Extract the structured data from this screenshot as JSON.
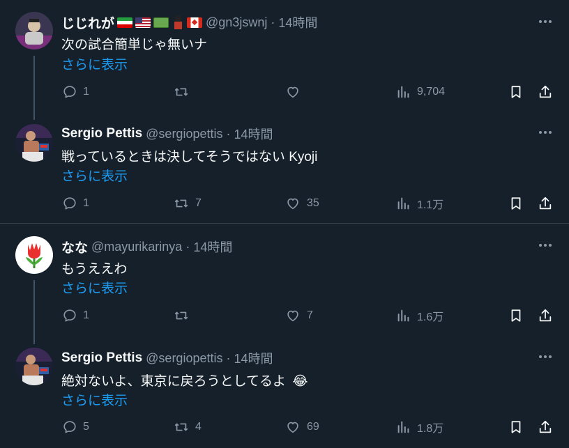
{
  "tweets": [
    {
      "name": "じじれが",
      "handle": "@gn3jswnj",
      "time": "14時間",
      "text": "次の試合簡単じゃ無いナ",
      "show_more": "さらに表示",
      "replies": "1",
      "retweets": "",
      "likes": "",
      "views": "9,704",
      "flags": [
        "iran-flag",
        "us-flag",
        "money-icon",
        "guard-icon",
        "canada-flag"
      ]
    },
    {
      "name": "Sergio Pettis",
      "handle": "@sergiopettis",
      "time": "14時間",
      "text": "戦っているときは決してそうではない Kyoji",
      "show_more": "さらに表示",
      "replies": "1",
      "retweets": "7",
      "likes": "35",
      "views": "1.1万"
    },
    {
      "name": "なな",
      "handle": "@mayurikarinya",
      "time": "14時間",
      "text": "もうええわ",
      "show_more": "さらに表示",
      "replies": "1",
      "retweets": "",
      "likes": "7",
      "views": "1.6万"
    },
    {
      "name": "Sergio Pettis",
      "handle": "@sergiopettis",
      "time": "14時間",
      "text": "絶対ないよ、東京に戻ろうとしてるよ",
      "emoji": "😂",
      "show_more": "さらに表示",
      "replies": "5",
      "retweets": "4",
      "likes": "69",
      "views": "1.8万"
    }
  ],
  "separator": "·",
  "colors": {
    "background": "#15202b",
    "text": "#f7f9f9",
    "muted": "#8b98a5",
    "link": "#1d9bf0",
    "divider": "#38444d"
  }
}
